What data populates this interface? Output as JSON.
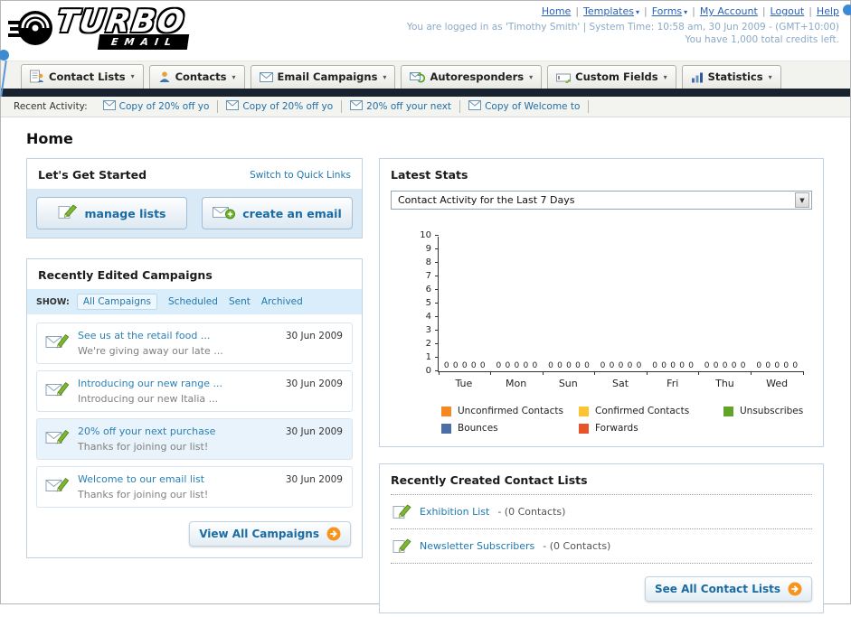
{
  "header": {
    "logo_line1": "TURBO",
    "logo_line2": "EMAIL",
    "nav_links": [
      {
        "label": "Home",
        "dropdown": false
      },
      {
        "label": "Templates",
        "dropdown": true
      },
      {
        "label": "Forms",
        "dropdown": true
      },
      {
        "label": "My Account",
        "dropdown": false
      },
      {
        "label": "Logout",
        "dropdown": false
      },
      {
        "label": "Help",
        "dropdown": false
      }
    ],
    "login_info": "You are logged in as 'Timothy Smith' | System Time: 10:58 am, 30 Jun 2009 - (GMT+10:00)",
    "credits_info": "You have 1,000 total credits left."
  },
  "nav_tabs": [
    {
      "label": "Contact Lists",
      "icon": "contact-lists-icon"
    },
    {
      "label": "Contacts",
      "icon": "contacts-icon"
    },
    {
      "label": "Email Campaigns",
      "icon": "email-campaigns-icon"
    },
    {
      "label": "Autoresponders",
      "icon": "autoresponders-icon"
    },
    {
      "label": "Custom Fields",
      "icon": "custom-fields-icon"
    },
    {
      "label": "Statistics",
      "icon": "statistics-icon"
    }
  ],
  "recent_activity": {
    "label": "Recent Activity:",
    "items": [
      "Copy of 20% off yo",
      "Copy of 20% off yo",
      "20% off your next",
      "Copy of Welcome to"
    ]
  },
  "page_title": "Home",
  "get_started": {
    "title": "Let's Get Started",
    "switch_link": "Switch to Quick Links",
    "buttons": [
      {
        "label": "manage lists",
        "icon": "pencil-icon"
      },
      {
        "label": "create an email",
        "icon": "envelope-plus-icon"
      }
    ]
  },
  "campaigns_panel": {
    "title": "Recently Edited Campaigns",
    "show_label": "SHOW:",
    "filters": [
      "All Campaigns",
      "Scheduled",
      "Sent",
      "Archived"
    ],
    "active_filter": "All Campaigns",
    "items": [
      {
        "title": "See us at the retail food ...",
        "subtitle": "We're giving away our late ...",
        "date": "30 Jun 2009",
        "highlighted": false
      },
      {
        "title": "Introducing our new range ...",
        "subtitle": "Introducing our new Italia ...",
        "date": "30 Jun 2009",
        "highlighted": false
      },
      {
        "title": "20% off your next purchase",
        "subtitle": "Thanks for joining our list!",
        "date": "30 Jun 2009",
        "highlighted": true
      },
      {
        "title": "Welcome to our email list",
        "subtitle": "Thanks for joining our list!",
        "date": "30 Jun 2009",
        "highlighted": false
      }
    ],
    "view_all_label": "View All Campaigns"
  },
  "stats_panel": {
    "title": "Latest Stats",
    "dropdown_value": "Contact Activity for the Last 7 Days"
  },
  "chart_data": {
    "type": "bar",
    "title": "Contact Activity for the Last 7 Days",
    "categories": [
      "Tue",
      "Mon",
      "Sun",
      "Sat",
      "Fri",
      "Thu",
      "Wed"
    ],
    "series": [
      {
        "name": "Unconfirmed Contacts",
        "color": "#f68820",
        "values": [
          0,
          0,
          0,
          0,
          0,
          0,
          0
        ]
      },
      {
        "name": "Confirmed Contacts",
        "color": "#fdc431",
        "values": [
          0,
          0,
          0,
          0,
          0,
          0,
          0
        ]
      },
      {
        "name": "Unsubscribes",
        "color": "#62a425",
        "values": [
          0,
          0,
          0,
          0,
          0,
          0,
          0
        ]
      },
      {
        "name": "Bounces",
        "color": "#4a6fa6",
        "values": [
          0,
          0,
          0,
          0,
          0,
          0,
          0
        ]
      },
      {
        "name": "Forwards",
        "color": "#e8542a",
        "values": [
          0,
          0,
          0,
          0,
          0,
          0,
          0
        ]
      }
    ],
    "xlabel": "",
    "ylabel": "",
    "ylim": [
      0,
      10
    ],
    "y_ticks": [
      0,
      1,
      2,
      3,
      4,
      5,
      6,
      7,
      8,
      9,
      10
    ],
    "grid": false,
    "legend_position": "bottom",
    "value_labels_shown": true
  },
  "contact_lists_panel": {
    "title": "Recently Created Contact Lists",
    "items": [
      {
        "name": "Exhibition List",
        "detail": "- (0 Contacts)"
      },
      {
        "name": "Newsletter Subscribers",
        "detail": "- (0 Contacts)"
      }
    ],
    "see_all_label": "See All Contact Lists"
  }
}
